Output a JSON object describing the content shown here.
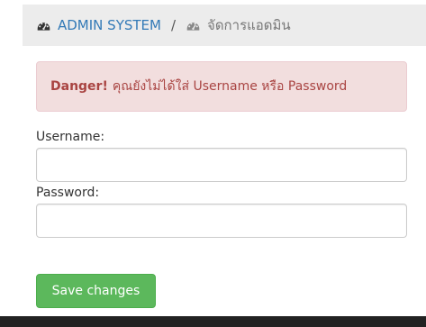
{
  "breadcrumb": {
    "items": [
      {
        "label": "ADMIN SYSTEM",
        "icon": "dashboard-icon"
      },
      {
        "label": "จัดการแอดมิน",
        "icon": "dashboard-icon"
      }
    ],
    "separator": "/"
  },
  "alert": {
    "strong": "Danger!",
    "message": "คุณยังไม่ได้ใส่ Username หรือ Password"
  },
  "form": {
    "username_label": "Username:",
    "username_value": "",
    "password_label": "Password:",
    "password_value": "",
    "submit_label": "Save changes"
  },
  "colors": {
    "breadcrumb_bg": "#ececec",
    "link": "#337ab7",
    "alert_bg": "#f2dede",
    "alert_text": "#a94442",
    "button": "#5cb85c",
    "footer": "#222222"
  }
}
